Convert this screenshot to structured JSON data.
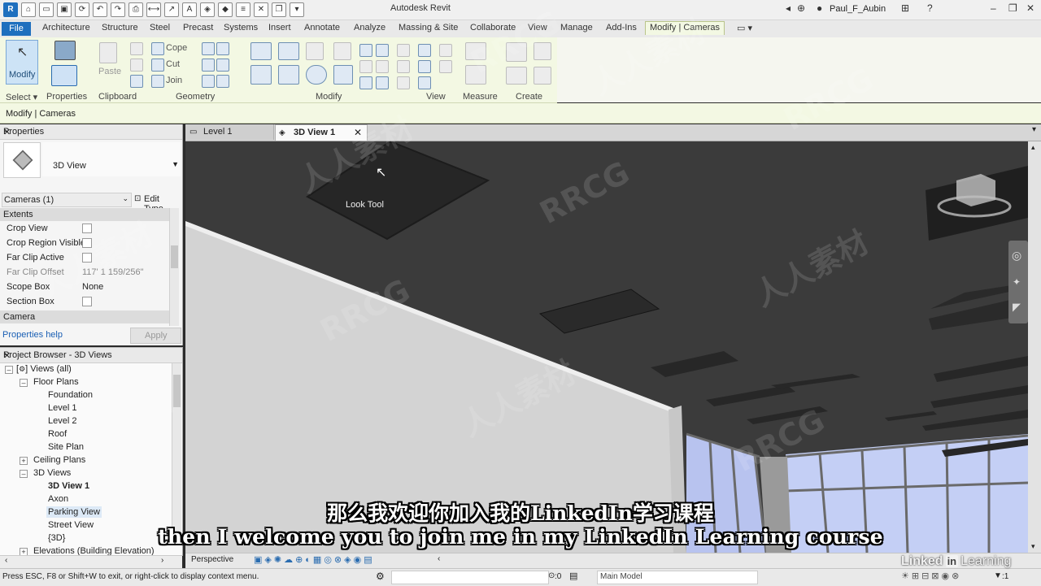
{
  "app": {
    "title": "Autodesk Revit",
    "user": "Paul_F_Aubin"
  },
  "tabs": [
    "File",
    "Architecture",
    "Structure",
    "Steel",
    "Precast",
    "Systems",
    "Insert",
    "Annotate",
    "Analyze",
    "Massing & Site",
    "Collaborate",
    "View",
    "Manage",
    "Add-Ins",
    "Modify | Cameras"
  ],
  "ribbon": {
    "modify_label": "Modify",
    "cope_label": "Cope",
    "cut_label": "Cut",
    "join_label": "Join",
    "paste_label": "Paste",
    "panels": [
      "Select",
      "Properties",
      "Clipboard",
      "Geometry",
      "Modify",
      "View",
      "Measure",
      "Create"
    ]
  },
  "context_bar": "Modify | Cameras",
  "properties": {
    "title": "Properties",
    "type_name": "3D View",
    "selector": "Cameras (1)",
    "edit_type": "Edit Type",
    "section_extents": "Extents",
    "section_camera": "Camera",
    "rows": [
      {
        "k": "Crop View",
        "v": ""
      },
      {
        "k": "Crop Region Visible",
        "v": ""
      },
      {
        "k": "Far Clip Active",
        "v": ""
      },
      {
        "k": "Far Clip Offset",
        "v": "117'  1 159/256\""
      },
      {
        "k": "Scope Box",
        "v": "None"
      },
      {
        "k": "Section Box",
        "v": ""
      }
    ],
    "help": "Properties help",
    "apply": "Apply"
  },
  "browser": {
    "title": "Project Browser - 3D Views",
    "items": [
      "Views (all)",
      "Floor Plans",
      "Foundation",
      "Level 1",
      "Level 2",
      "Roof",
      "Site Plan",
      "Ceiling Plans",
      "3D Views",
      "3D View 1",
      "Axon",
      "Parking View",
      "Street View",
      "{3D}",
      "Elevations (Building Elevation)"
    ]
  },
  "view_tabs": [
    "Level 1",
    "3D View 1"
  ],
  "viewport": {
    "tooltip": "Look Tool"
  },
  "view_bar": {
    "mode": "Perspective"
  },
  "status": {
    "hint": "Press ESC, F8 or Shift+W to exit, or right-click to display context menu.",
    "model": "Main Model",
    "count": ":0",
    "filter": ":1"
  },
  "subtitles": {
    "zh": "那么我欢迎你加入我的LinkedIn学习课程",
    "en": "then I welcome you to join me in my LinkedIn Learning course"
  },
  "branding": {
    "watermark_latin": "RRCG",
    "watermark_cjk": "人人素材",
    "learning": "Learning",
    "linked": "Linked",
    "in": "in"
  },
  "colors": {
    "ribbon_bg": "#f3f8e3",
    "file_tab": "#1e6fbe",
    "ceiling": "#3c3c3c",
    "wall": "#d2d2d2",
    "glass": "#b9c6f2"
  }
}
